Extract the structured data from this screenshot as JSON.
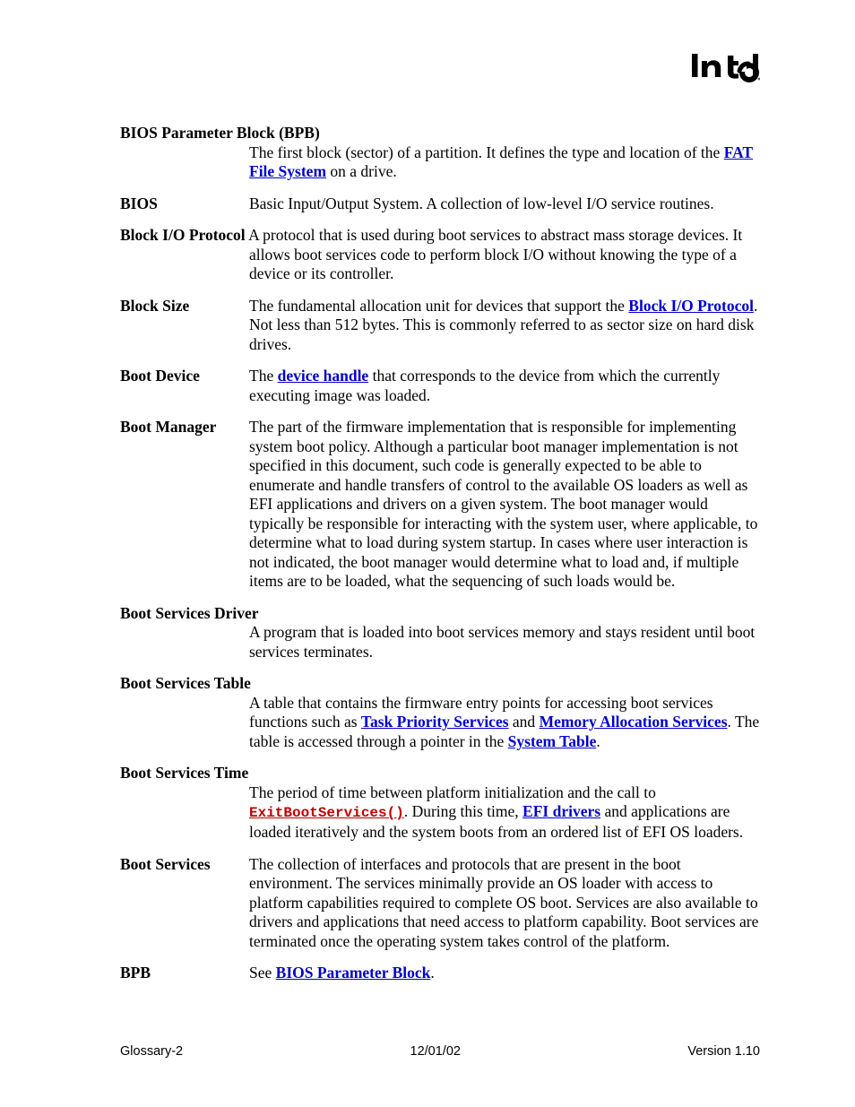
{
  "logo": {
    "alt": "intel-logo"
  },
  "entries": [
    {
      "term": "BIOS Parameter Block (BPB)",
      "longTerm": true,
      "def_pre": "The first block (sector) of a partition.  It defines the type and location of the ",
      "link1": "FAT File System",
      "def_post": " on a drive."
    },
    {
      "term": "BIOS",
      "def": "Basic Input/Output System.  A collection of low-level I/O service routines."
    },
    {
      "term": "Block I/O Protocol",
      "inlineTerm": true,
      "def": "A protocol that is used during boot services to abstract mass storage devices.  It allows boot services code to perform block I/O without knowing the type of a device or its controller."
    },
    {
      "term": "Block Size",
      "def_pre": "The fundamental allocation unit for devices that support the ",
      "link1": "Block I/O Protocol",
      "def_post": ".  Not less than 512 bytes.  This is commonly referred to as sector size on hard disk drives."
    },
    {
      "term": "Boot Device",
      "def_pre": "The ",
      "link1": "device handle",
      "def_post": " that corresponds to the device from which the currently executing image was loaded."
    },
    {
      "term": "Boot Manager",
      "def": "The part of the firmware implementation that is responsible for implementing system boot policy.  Although a particular boot manager implementation is not specified in this document, such code is generally expected to be able to enumerate and handle transfers of control to the available OS loaders as well as EFI applications and drivers on a given system.  The boot manager would typically be responsible for interacting with the system user, where applicable, to determine what to load during system startup.  In cases where user interaction is not indicated, the boot manager would determine what to load and, if multiple items are to be loaded, what the sequencing of such loads would be."
    },
    {
      "term": "Boot Services Driver",
      "longTerm": true,
      "def": "A program that is loaded into boot services memory and stays resident until boot services terminates."
    },
    {
      "term": "Boot Services Table",
      "longTerm": true,
      "def_pre": "A table that contains the firmware entry points for accessing boot services functions such as ",
      "link1": "Task Priority Services",
      "def_mid1": " and ",
      "link2": "Memory Allocation Services",
      "def_mid2": ".  The table is accessed through a pointer in the ",
      "link3": "System Table",
      "def_post": "."
    },
    {
      "term": "Boot Services Time",
      "longTerm": true,
      "def_pre": "The period of time between platform initialization and the call to ",
      "code1": "ExitBootServices()",
      "def_mid1": ".  During this time, ",
      "link1": "EFI drivers",
      "def_post": " and applications are loaded iteratively and the system boots from an ordered list of EFI OS loaders."
    },
    {
      "term": "Boot Services",
      "def": "The collection of interfaces and protocols that are present in the boot environment.  The services minimally provide an OS loader with access to platform capabilities required to complete OS boot.  Services are also available to drivers and applications that need access to platform capability.  Boot services are terminated once the operating system takes control of the platform."
    },
    {
      "term": "BPB",
      "def_pre": "See ",
      "link1": "BIOS Parameter Block",
      "def_post": "."
    }
  ],
  "footer": {
    "left": "Glossary-2",
    "center": "12/01/02",
    "right": "Version 1.10"
  }
}
